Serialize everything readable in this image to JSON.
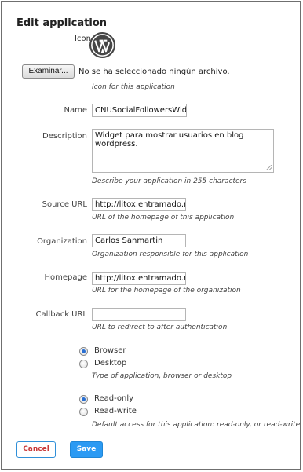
{
  "dialog": {
    "title": "Edit application"
  },
  "icon_section": {
    "label": "Icon",
    "logo_icon": "wordpress-logo-icon",
    "file_button": "Examinar...",
    "file_status": "No se ha seleccionado ningún archivo.",
    "hint": "Icon for this application"
  },
  "fields": {
    "name": {
      "label": "Name",
      "value": "CNUSocialFollowersWidget"
    },
    "description": {
      "label": "Description",
      "value": "Widget para mostrar usuarios en blog wordpress.",
      "hint": "Describe your application in 255 characters"
    },
    "source_url": {
      "label": "Source URL",
      "value": "http://litox.entramado.net",
      "hint": "URL of the homepage of this application"
    },
    "organization": {
      "label": "Organization",
      "value": "Carlos Sanmartin",
      "hint": "Organization responsible for this application"
    },
    "homepage": {
      "label": "Homepage",
      "value": "http://litox.entramado.net",
      "hint": "URL for the homepage of the organization"
    },
    "callback_url": {
      "label": "Callback URL",
      "value": "",
      "hint": "URL to redirect to after authentication"
    }
  },
  "app_type": {
    "options": [
      "Browser",
      "Desktop"
    ],
    "selected": "Browser",
    "hint": "Type of application, browser or desktop"
  },
  "access": {
    "options": [
      "Read-only",
      "Read-write"
    ],
    "selected": "Read-only",
    "hint": "Default access for this application: read-only, or read-write"
  },
  "actions": {
    "cancel": "Cancel",
    "save": "Save"
  },
  "colors": {
    "accent": "#2b9af3",
    "cancel_text": "#c93a3a",
    "radio_selected": "#2a6fd1"
  }
}
